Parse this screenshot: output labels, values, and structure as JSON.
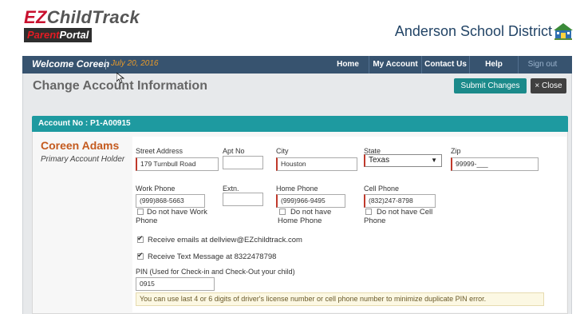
{
  "header": {
    "logo_prefix": "EZ",
    "logo_suffix": "ChildTrack",
    "portal_prefix": "Parent",
    "portal_suffix": "Portal",
    "district": "Anderson School District"
  },
  "topnav": {
    "welcome": "Welcome Coreen",
    "date": "July 20, 2016",
    "items": [
      "Home",
      "My Account",
      "Contact Us",
      "Help",
      "Sign out"
    ]
  },
  "page": {
    "title": "Change Account Information",
    "submit_label": "Submit Changes",
    "close_label": "× Close"
  },
  "account": {
    "bar_label": "Account No :  P1-A00915",
    "holder_name": "Coreen Adams",
    "holder_role": "Primary Account Holder"
  },
  "form": {
    "street_label": "Street Address",
    "street_value": "179 Turnbull Road",
    "apt_label": "Apt No",
    "apt_value": "",
    "city_label": "City",
    "city_value": "Houston",
    "state_label": "State",
    "state_value": "Texas",
    "zip_label": "Zip",
    "zip_value": "99999-___",
    "work_label": "Work Phone",
    "work_value": "(999)868-5663",
    "extn_label": "Extn.",
    "extn_value": "",
    "home_label": "Home Phone",
    "home_value": "(999)966-9495",
    "cell_label": "Cell Phone",
    "cell_value": "(832)247-8798",
    "no_work_label_1": "Do not have Work",
    "no_work_label_2": "Phone",
    "no_home_label_1": "Do not have",
    "no_home_label_2": "Home Phone",
    "no_cell_label_1": "Do not have Cell",
    "no_cell_label_2": "Phone",
    "email_opt_label": "Receive emails at dellview@EZchildtrack.com",
    "text_opt_label": "Receive Text Message at 8322478798",
    "pin_label": "PIN (Used for Check-in and Check-Out your child)",
    "pin_value": "0915",
    "pin_hint": "You can use last 4 or 6 digits of driver's license number or cell phone number to minimize duplicate PIN error."
  },
  "colors": {
    "nav_bg": "#37536f",
    "teal": "#1e9aa0",
    "accent_orange": "#c45a1e",
    "brand_red": "#c8102e"
  }
}
